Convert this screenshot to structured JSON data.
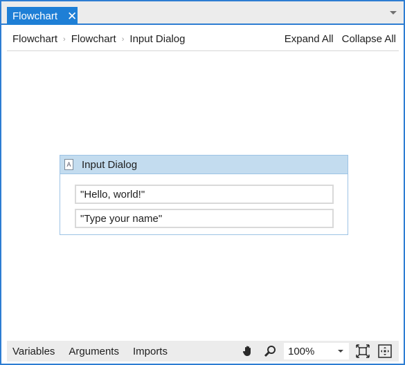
{
  "tab": {
    "title": "Flowchart",
    "close_glyph": "✕"
  },
  "breadcrumb": {
    "items": [
      "Flowchart",
      "Flowchart",
      "Input Dialog"
    ],
    "separator": "›",
    "expand_all": "Expand All",
    "collapse_all": "Collapse All"
  },
  "activity": {
    "title": "Input Dialog",
    "icon_glyph": "A",
    "fields": [
      "\"Hello, world!\"",
      "\"Type your name\""
    ]
  },
  "bottombar": {
    "variables": "Variables",
    "arguments": "Arguments",
    "imports": "Imports",
    "zoom": "100%",
    "icons": [
      "hand-pan-icon",
      "magnifier-icon",
      "fit-to-screen-icon",
      "overview-icon"
    ]
  },
  "colors": {
    "accent": "#1e7fd6",
    "activity_header": "#c3dcef",
    "activity_border": "#9cc3e5"
  }
}
